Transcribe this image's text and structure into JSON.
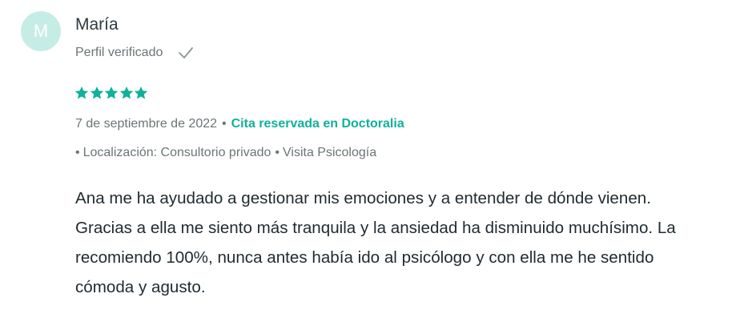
{
  "author": {
    "initial": "M",
    "name": "María",
    "avatar_color": "#c6ede5"
  },
  "verified": {
    "label": "Perfil verificado",
    "icon": "check-icon"
  },
  "rating": {
    "stars": 5,
    "max": 5,
    "color": "#11b09a"
  },
  "meta": {
    "date": "7 de septiembre de 2022",
    "separator": "•",
    "booking_label": "Cita reservada en Doctoralia",
    "booking_color": "#11b09a"
  },
  "details": {
    "bullet": "•",
    "location": "Localización: Consultorio privado",
    "visit_type": "Visita Psicología"
  },
  "review": {
    "text": "Ana me ha ayudado a gestionar mis emociones y a entender de dónde vienen. Gracias a ella me siento más tranquila y la ansiedad ha disminuido muchísimo. La recomiendo 100%, nunca antes había ido al psicólogo y con ella me he sentido cómoda y agusto."
  }
}
